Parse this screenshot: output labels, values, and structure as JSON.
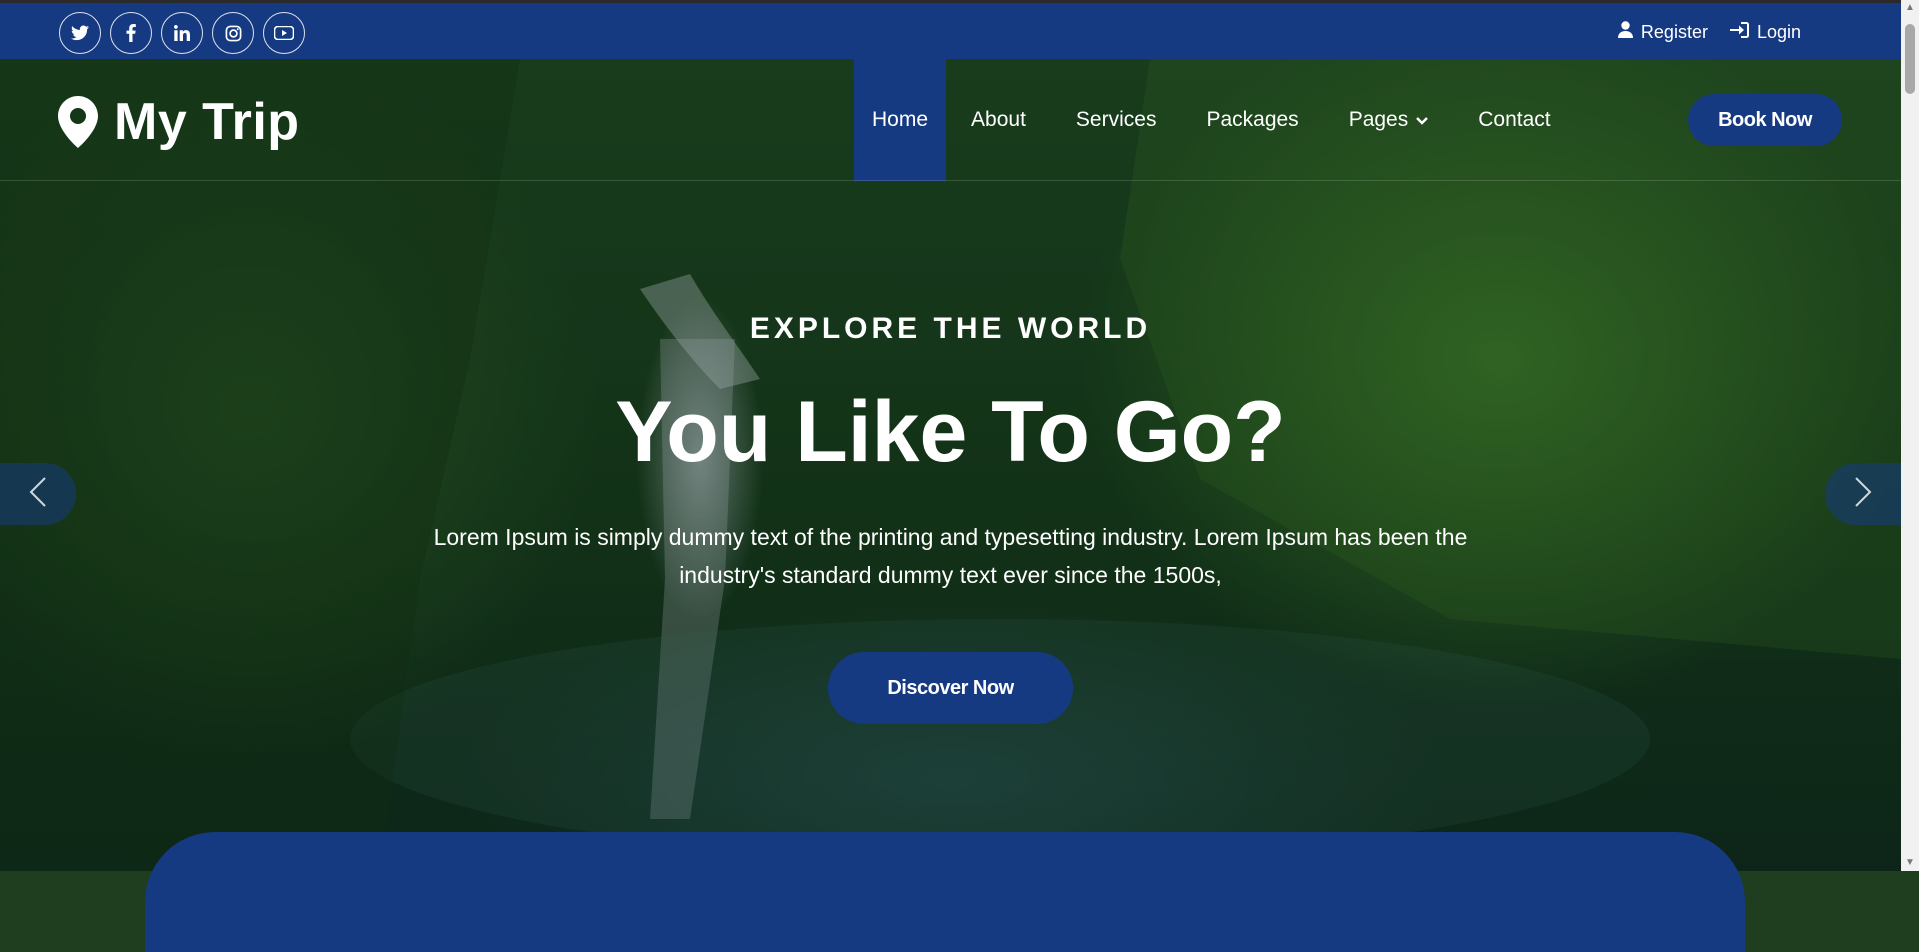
{
  "topbar": {
    "social": [
      {
        "icon": "twitter-icon",
        "glyph": "🐦"
      },
      {
        "icon": "facebook-icon",
        "glyph": "f"
      },
      {
        "icon": "linkedin-icon",
        "glyph": "in"
      },
      {
        "icon": "instagram-icon",
        "glyph": "◎"
      },
      {
        "icon": "youtube-icon",
        "glyph": "▶"
      }
    ],
    "register_label": "Register",
    "login_label": "Login"
  },
  "brand": {
    "name": "My Trip"
  },
  "nav": {
    "items": [
      "Home",
      "About",
      "Services",
      "Packages",
      "Pages",
      "Contact"
    ],
    "active": "Home",
    "book_label": "Book Now"
  },
  "hero": {
    "eyebrow": "EXPLORE THE WORLD",
    "headline": "You Like To Go?",
    "lead": "Lorem Ipsum is simply dummy text of the printing and typesetting industry. Lorem Ipsum has been the industry's standard dummy text ever since the 1500s,",
    "cta_label": "Discover Now"
  },
  "colors": {
    "primary": "#163a82",
    "text": "#ffffff"
  }
}
